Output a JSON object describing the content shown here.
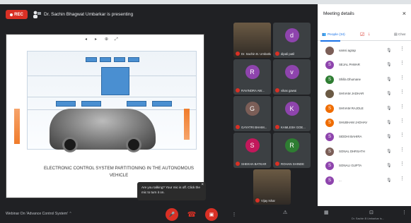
{
  "recording_badge": "REC",
  "presenter_banner": "Dr. Sachin Bhagwat Umbarkar is presenting",
  "slide": {
    "caption_line1": "ELECTRONIC CONTROL SYSTEM PARTITIONING IN THE AUTONOMOUS",
    "caption_line2": "VEHICLE"
  },
  "tooltip": {
    "text": "Are you talking? Your mic is off. Click the mic to turn it on."
  },
  "tiles": [
    {
      "initial": "",
      "name": "Dr. Sachin B. Umbarkar",
      "color": "#6b5a44"
    },
    {
      "initial": "d",
      "name": "dipali patil",
      "color": "#8e44ad"
    },
    {
      "initial": "R",
      "name": "RAVINDRA AW...",
      "color": "#8e44ad"
    },
    {
      "initial": "v",
      "name": "vikas gawai",
      "color": "#8e44ad"
    },
    {
      "initial": "G",
      "name": "GAYATRI BHAIM...",
      "color": "#7b5e57"
    },
    {
      "initial": "K",
      "name": "KAMLESH GOE...",
      "color": "#8e44ad"
    },
    {
      "initial": "S",
      "name": "SHEKHA BATKAR",
      "color": "#c2185b"
    },
    {
      "initial": "R",
      "name": "ROHAN SHINDE",
      "color": "#2e7d32"
    },
    {
      "initial": "",
      "name": "Vijay Ishar",
      "color": "#6b5a44"
    }
  ],
  "panel": {
    "title": "Meeting details",
    "tab_people": "People (34)",
    "tab_chat": "Chat",
    "participants": [
      {
        "initial": "",
        "name": "vamsi agrap",
        "color": "#7b5e57"
      },
      {
        "initial": "S",
        "name": "SEJAL PAWAR",
        "color": "#8e44ad"
      },
      {
        "initial": "S",
        "name": "Shilla Dhumane",
        "color": "#2e7d32"
      },
      {
        "initial": "",
        "name": "SHIVAM JADHAR",
        "color": "#6b5a44"
      },
      {
        "initial": "S",
        "name": "SHIVAM RAJOLE",
        "color": "#ef6c00"
      },
      {
        "initial": "S",
        "name": "SHUBHAM JADHAV",
        "color": "#ef6c00"
      },
      {
        "initial": "S",
        "name": "SIDDHI BAHIRA",
        "color": "#8e44ad"
      },
      {
        "initial": "S",
        "name": "SONAL DHRSATH",
        "color": "#7b5e57"
      },
      {
        "initial": "S",
        "name": "SONALI GUPTA",
        "color": "#8e44ad"
      },
      {
        "initial": "S",
        "name": "...",
        "color": "#8e44ad"
      }
    ]
  },
  "bottom": {
    "meeting_name": "Webinar On 'Advance Control System'",
    "presenter_label": "Dr. Sachin B Umbarkar is..."
  }
}
